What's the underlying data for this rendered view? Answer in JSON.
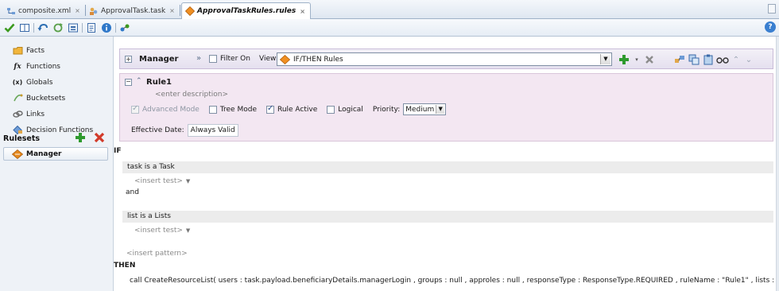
{
  "tabs": [
    {
      "label": "composite.xml",
      "close": "×",
      "active": false
    },
    {
      "label": "ApprovalTask.task",
      "close": "×",
      "active": false
    },
    {
      "label": "ApprovalTaskRules.rules",
      "close": "×",
      "active": true
    }
  ],
  "toolbar": {
    "icons": [
      "validate-icon",
      "book-icon",
      "undo-icon",
      "refresh-icon",
      "tree-icon",
      "document-icon",
      "info-icon",
      "link-icon"
    ],
    "help": "?"
  },
  "nav": {
    "items": [
      {
        "label": "Facts",
        "icon": "facts-icon"
      },
      {
        "label": "Functions",
        "icon": "functions-icon"
      },
      {
        "label": "Globals",
        "icon": "globals-icon"
      },
      {
        "label": "Bucketsets",
        "icon": "bucketsets-icon"
      },
      {
        "label": "Links",
        "icon": "links-icon"
      },
      {
        "label": "Decision Functions",
        "icon": "decision-functions-icon"
      }
    ],
    "functions_glyph": "fx",
    "globals_glyph": "(x)",
    "rulesets_label": "Rulesets",
    "ruleset_selected": "Manager"
  },
  "manager": {
    "title": "Manager",
    "filter_label": "Filter On",
    "filter_on": false,
    "view_label": "View:",
    "view_value": "IF/THEN Rules"
  },
  "rule": {
    "name": "Rule1",
    "description": "<enter description>",
    "advanced_mode": {
      "label": "Advanced Mode",
      "checked": true,
      "enabled": false
    },
    "tree_mode": {
      "label": "Tree Mode",
      "checked": false
    },
    "rule_active": {
      "label": "Rule Active",
      "checked": true
    },
    "logical": {
      "label": "Logical",
      "checked": false
    },
    "priority_label": "Priority:",
    "priority_value": "Medium",
    "effective_label": "Effective Date:",
    "effective_value": "Always Valid"
  },
  "body": {
    "if_kw": "IF",
    "pattern1": "task is a Task",
    "insert_test": "<insert test>",
    "and_kw": "and",
    "pattern2": "list is a Lists",
    "insert_pattern": "<insert pattern>",
    "then_kw": "THEN",
    "action": "call CreateResourceList( users : task.payload.beneficiaryDetails.managerLogin , groups : null , approles : null , responseType : ResponseType.REQUIRED , ruleName : \"Rule1\" , lists : list"
  },
  "colors": {
    "rule_panel_bg": "#f3e7f2",
    "manager_bar_bg": "#e5e0ef",
    "add_green": "#2e9a2e",
    "delete_red": "#d23a2a",
    "ruleset_orange": "#e58a1f"
  }
}
